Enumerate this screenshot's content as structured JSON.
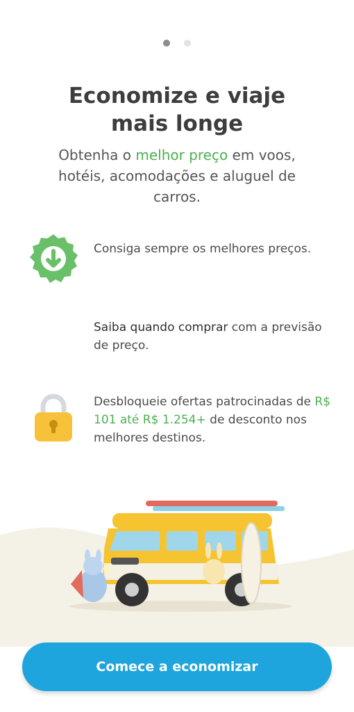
{
  "pager": {
    "current": 1,
    "total": 2
  },
  "header": {
    "title_line1": "Economize e viaje",
    "title_line2": "mais longe",
    "subtitle_pre": "Obtenha o ",
    "subtitle_highlight": "melhor preço",
    "subtitle_post": " em voos, hotéis, acomodações e aluguel de carros."
  },
  "features": [
    {
      "icon": "download-badge-icon",
      "text": "Consiga sempre os melhores preços."
    },
    {
      "icon": "none",
      "strong": "Saiba quando comprar",
      "text": " com a previsão de preço."
    },
    {
      "icon": "lock-icon",
      "pre": "Desbloqueie ofertas patrocinadas de ",
      "highlight": "R$ 101 até R$ 1.254+",
      "post": " de desconto nos melhores destinos."
    }
  ],
  "cta": {
    "label": "Comece a economizar"
  },
  "colors": {
    "accent": "#1ea5dd",
    "highlight": "#4caf50",
    "badge": "#6abf69",
    "lock": "#f7c23a"
  }
}
